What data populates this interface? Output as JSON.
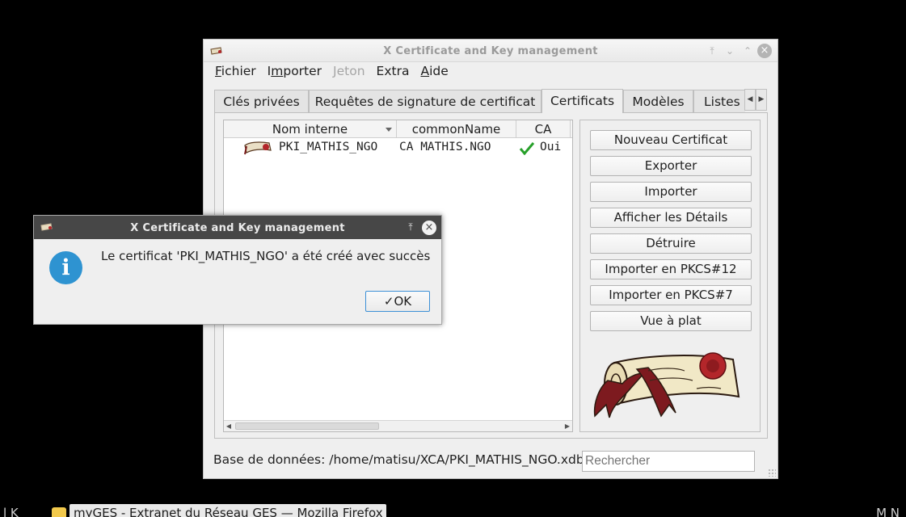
{
  "main_window": {
    "title": "X Certificate and Key management",
    "menu": [
      "Fichier",
      "Importer",
      "Jeton",
      "Extra",
      "Aide"
    ],
    "tabs": [
      "Clés privées",
      "Requêtes de signature de certificat",
      "Certificats",
      "Modèles",
      "Listes"
    ],
    "active_tab": "Certificats",
    "table": {
      "columns": [
        "Nom interne",
        "commonName",
        "CA"
      ],
      "rows": [
        {
          "nom_interne": "PKI_MATHIS_NGO",
          "common_name": "CA MATHIS.NGO",
          "ca": "Oui"
        }
      ]
    },
    "buttons": [
      "Nouveau Certificat",
      "Exporter",
      "Importer",
      "Afficher les Détails",
      "Détruire",
      "Importer en PKCS#12",
      "Importer en PKCS#7",
      "Vue à plat"
    ],
    "status": {
      "db_label": "Base de données: /home/matisu/XCA/PKI_MATHIS_NGO.xdb",
      "search_placeholder": "Rechercher"
    }
  },
  "dialog": {
    "title": "X Certificate and Key management",
    "message": "Le certificat 'PKI_MATHIS_NGO' a été créé avec succès",
    "ok_label": "OK",
    "icon": "info-icon"
  },
  "taskbar": {
    "left_fragment": "l K",
    "window_entry": "myGES - Extranet du Réseau GES — Mozilla Firefox",
    "right_fragment": "M N"
  },
  "colors": {
    "desktop": "#000000",
    "window_bg": "#efefef",
    "dialog_titlebar": "#474747",
    "info_blue": "#2e93d1",
    "check_green": "#27a02a",
    "seal_red": "#b3262a"
  }
}
